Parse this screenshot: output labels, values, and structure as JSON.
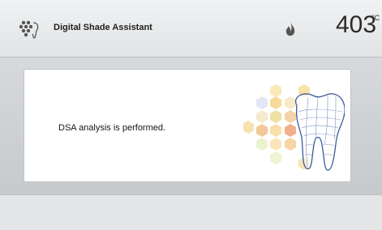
{
  "header": {
    "title": "Digital Shade Assistant",
    "temperature": "403",
    "temperature_unit": "°C",
    "app_icon": "dsa-dots-icon",
    "status_icon": "flame-icon"
  },
  "panel": {
    "message": "DSA analysis is performed.",
    "illustration": "tooth-shade-illustration"
  },
  "colors": {
    "panel_bg": "#ffffff",
    "header_bg": "#e6e8ea",
    "tooth_outline": "#3b5c9a"
  }
}
